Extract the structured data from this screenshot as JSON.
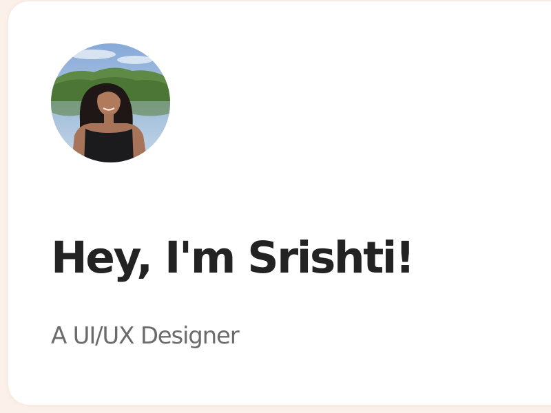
{
  "hero": {
    "headline": "Hey, I'm Srishti!",
    "subtitle": "A UI/UX Designer",
    "avatar_icon": "profile-photo-icon"
  },
  "colors": {
    "page_background": "#fbf1ea",
    "card_background": "#ffffff",
    "headline_text": "#232323",
    "subtitle_text": "#6b6b6b"
  }
}
